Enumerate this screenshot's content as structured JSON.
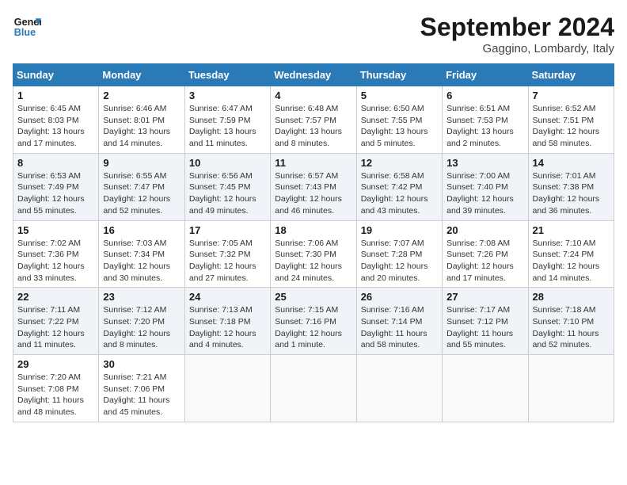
{
  "header": {
    "logo_line1": "General",
    "logo_line2": "Blue",
    "month_title": "September 2024",
    "location": "Gaggino, Lombardy, Italy"
  },
  "columns": [
    "Sunday",
    "Monday",
    "Tuesday",
    "Wednesday",
    "Thursday",
    "Friday",
    "Saturday"
  ],
  "weeks": [
    [
      {
        "day": "1",
        "sunrise": "6:45 AM",
        "sunset": "8:03 PM",
        "daylight": "13 hours and 17 minutes."
      },
      {
        "day": "2",
        "sunrise": "6:46 AM",
        "sunset": "8:01 PM",
        "daylight": "13 hours and 14 minutes."
      },
      {
        "day": "3",
        "sunrise": "6:47 AM",
        "sunset": "7:59 PM",
        "daylight": "13 hours and 11 minutes."
      },
      {
        "day": "4",
        "sunrise": "6:48 AM",
        "sunset": "7:57 PM",
        "daylight": "13 hours and 8 minutes."
      },
      {
        "day": "5",
        "sunrise": "6:50 AM",
        "sunset": "7:55 PM",
        "daylight": "13 hours and 5 minutes."
      },
      {
        "day": "6",
        "sunrise": "6:51 AM",
        "sunset": "7:53 PM",
        "daylight": "13 hours and 2 minutes."
      },
      {
        "day": "7",
        "sunrise": "6:52 AM",
        "sunset": "7:51 PM",
        "daylight": "12 hours and 58 minutes."
      }
    ],
    [
      {
        "day": "8",
        "sunrise": "6:53 AM",
        "sunset": "7:49 PM",
        "daylight": "12 hours and 55 minutes."
      },
      {
        "day": "9",
        "sunrise": "6:55 AM",
        "sunset": "7:47 PM",
        "daylight": "12 hours and 52 minutes."
      },
      {
        "day": "10",
        "sunrise": "6:56 AM",
        "sunset": "7:45 PM",
        "daylight": "12 hours and 49 minutes."
      },
      {
        "day": "11",
        "sunrise": "6:57 AM",
        "sunset": "7:43 PM",
        "daylight": "12 hours and 46 minutes."
      },
      {
        "day": "12",
        "sunrise": "6:58 AM",
        "sunset": "7:42 PM",
        "daylight": "12 hours and 43 minutes."
      },
      {
        "day": "13",
        "sunrise": "7:00 AM",
        "sunset": "7:40 PM",
        "daylight": "12 hours and 39 minutes."
      },
      {
        "day": "14",
        "sunrise": "7:01 AM",
        "sunset": "7:38 PM",
        "daylight": "12 hours and 36 minutes."
      }
    ],
    [
      {
        "day": "15",
        "sunrise": "7:02 AM",
        "sunset": "7:36 PM",
        "daylight": "12 hours and 33 minutes."
      },
      {
        "day": "16",
        "sunrise": "7:03 AM",
        "sunset": "7:34 PM",
        "daylight": "12 hours and 30 minutes."
      },
      {
        "day": "17",
        "sunrise": "7:05 AM",
        "sunset": "7:32 PM",
        "daylight": "12 hours and 27 minutes."
      },
      {
        "day": "18",
        "sunrise": "7:06 AM",
        "sunset": "7:30 PM",
        "daylight": "12 hours and 24 minutes."
      },
      {
        "day": "19",
        "sunrise": "7:07 AM",
        "sunset": "7:28 PM",
        "daylight": "12 hours and 20 minutes."
      },
      {
        "day": "20",
        "sunrise": "7:08 AM",
        "sunset": "7:26 PM",
        "daylight": "12 hours and 17 minutes."
      },
      {
        "day": "21",
        "sunrise": "7:10 AM",
        "sunset": "7:24 PM",
        "daylight": "12 hours and 14 minutes."
      }
    ],
    [
      {
        "day": "22",
        "sunrise": "7:11 AM",
        "sunset": "7:22 PM",
        "daylight": "12 hours and 11 minutes."
      },
      {
        "day": "23",
        "sunrise": "7:12 AM",
        "sunset": "7:20 PM",
        "daylight": "12 hours and 8 minutes."
      },
      {
        "day": "24",
        "sunrise": "7:13 AM",
        "sunset": "7:18 PM",
        "daylight": "12 hours and 4 minutes."
      },
      {
        "day": "25",
        "sunrise": "7:15 AM",
        "sunset": "7:16 PM",
        "daylight": "12 hours and 1 minute."
      },
      {
        "day": "26",
        "sunrise": "7:16 AM",
        "sunset": "7:14 PM",
        "daylight": "11 hours and 58 minutes."
      },
      {
        "day": "27",
        "sunrise": "7:17 AM",
        "sunset": "7:12 PM",
        "daylight": "11 hours and 55 minutes."
      },
      {
        "day": "28",
        "sunrise": "7:18 AM",
        "sunset": "7:10 PM",
        "daylight": "11 hours and 52 minutes."
      }
    ],
    [
      {
        "day": "29",
        "sunrise": "7:20 AM",
        "sunset": "7:08 PM",
        "daylight": "11 hours and 48 minutes."
      },
      {
        "day": "30",
        "sunrise": "7:21 AM",
        "sunset": "7:06 PM",
        "daylight": "11 hours and 45 minutes."
      },
      null,
      null,
      null,
      null,
      null
    ]
  ]
}
